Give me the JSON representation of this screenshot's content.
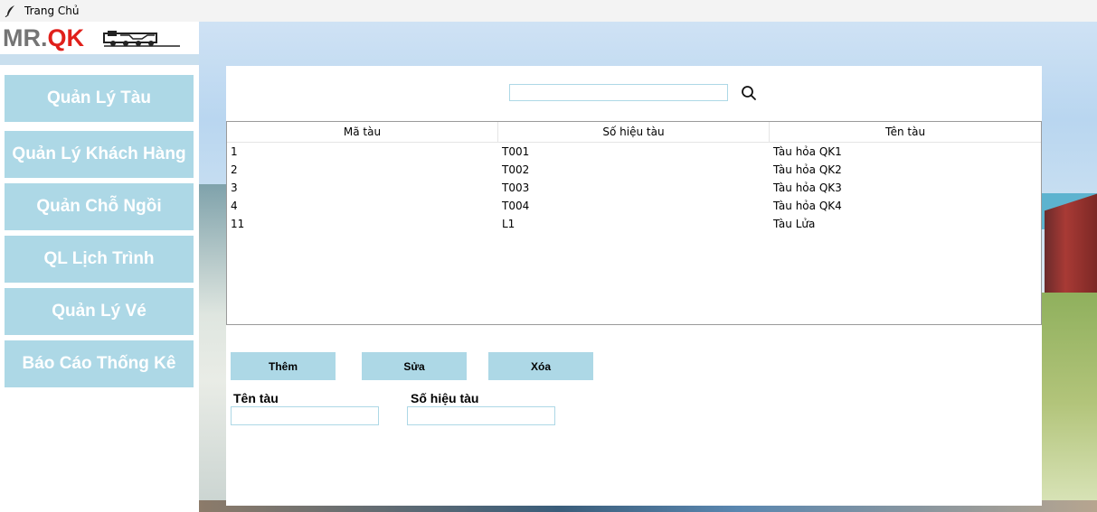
{
  "window": {
    "title": "Trang Chủ",
    "icon": "feather-icon"
  },
  "logo": {
    "text_mr": "MR.",
    "text_qk": "QK",
    "brand_gray": "#757575",
    "brand_red": "#e0201b",
    "train_icon": "train-logo-icon"
  },
  "sidebar": {
    "items": [
      {
        "label": "Quản Lý Tàu"
      },
      {
        "label": "Quản Lý Khách Hàng"
      },
      {
        "label": "Quản Chỗ Ngồi"
      },
      {
        "label": "QL Lịch Trình"
      },
      {
        "label": "Quản Lý Vé"
      },
      {
        "label": "Báo Cáo Thống Kê"
      }
    ]
  },
  "search": {
    "value": "",
    "icon": "search-icon"
  },
  "table": {
    "columns": [
      "Mã tàu",
      "Số hiệu tàu",
      "Tên tàu"
    ],
    "rows": [
      [
        "1",
        "T001",
        "Tàu hỏa QK1"
      ],
      [
        "2",
        "T002",
        "Tàu hỏa QK2"
      ],
      [
        "3",
        "T003",
        "Tàu hỏa QK3"
      ],
      [
        "4",
        "T004",
        "Tàu hỏa QK4"
      ],
      [
        "11",
        "L1",
        "Tàu Lửa"
      ]
    ]
  },
  "actions": {
    "add": "Thêm",
    "edit": "Sửa",
    "delete": "Xóa"
  },
  "form": {
    "name_label": "Tên tàu",
    "name_value": "",
    "code_label": "Số hiệu tàu",
    "code_value": ""
  },
  "colors": {
    "accent": "#add8e6",
    "panel": "#ffffff"
  }
}
